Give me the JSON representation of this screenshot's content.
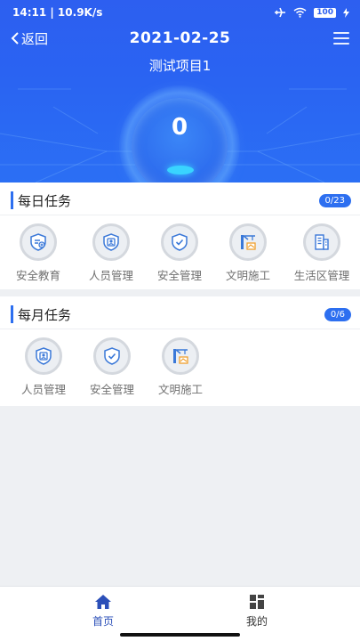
{
  "status_bar": {
    "time_speed": "14:11 | 10.9K/s",
    "battery": "100"
  },
  "nav": {
    "back_label": "返回",
    "date": "2021-02-25",
    "project_name": "测试项目1"
  },
  "summary": {
    "score": "0"
  },
  "daily": {
    "title": "每日任务",
    "badge": "0/23",
    "items": [
      {
        "label": "安全教育",
        "icon": "education-shield-icon"
      },
      {
        "label": "人员管理",
        "icon": "person-shield-icon"
      },
      {
        "label": "安全管理",
        "icon": "check-shield-icon"
      },
      {
        "label": "文明施工",
        "icon": "crane-construction-icon"
      },
      {
        "label": "生活区管理",
        "icon": "building-icon"
      }
    ]
  },
  "monthly": {
    "title": "每月任务",
    "badge": "0/6",
    "items": [
      {
        "label": "人员管理",
        "icon": "person-shield-icon"
      },
      {
        "label": "安全管理",
        "icon": "check-shield-icon"
      },
      {
        "label": "文明施工",
        "icon": "crane-construction-icon"
      }
    ]
  },
  "tabbar": {
    "home_label": "首页",
    "mine_label": "我的"
  },
  "colors": {
    "primary": "#2d6ff0",
    "header_blue": "#2d5ff0",
    "icon_gray": "#d4d8de",
    "label_gray": "#6f6f6f"
  }
}
